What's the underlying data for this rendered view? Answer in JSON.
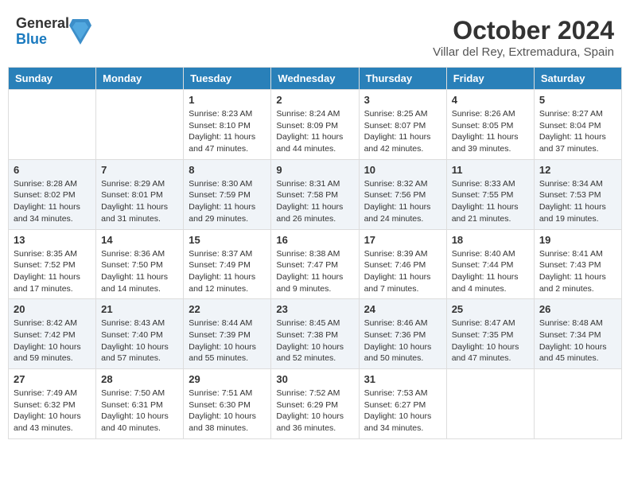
{
  "header": {
    "logo": {
      "general": "General",
      "blue": "Blue"
    },
    "title": "October 2024",
    "subtitle": "Villar del Rey, Extremadura, Spain"
  },
  "weekdays": [
    "Sunday",
    "Monday",
    "Tuesday",
    "Wednesday",
    "Thursday",
    "Friday",
    "Saturday"
  ],
  "weeks": [
    [
      null,
      null,
      {
        "day": "1",
        "sunrise": "Sunrise: 8:23 AM",
        "sunset": "Sunset: 8:10 PM",
        "daylight": "Daylight: 11 hours and 47 minutes."
      },
      {
        "day": "2",
        "sunrise": "Sunrise: 8:24 AM",
        "sunset": "Sunset: 8:09 PM",
        "daylight": "Daylight: 11 hours and 44 minutes."
      },
      {
        "day": "3",
        "sunrise": "Sunrise: 8:25 AM",
        "sunset": "Sunset: 8:07 PM",
        "daylight": "Daylight: 11 hours and 42 minutes."
      },
      {
        "day": "4",
        "sunrise": "Sunrise: 8:26 AM",
        "sunset": "Sunset: 8:05 PM",
        "daylight": "Daylight: 11 hours and 39 minutes."
      },
      {
        "day": "5",
        "sunrise": "Sunrise: 8:27 AM",
        "sunset": "Sunset: 8:04 PM",
        "daylight": "Daylight: 11 hours and 37 minutes."
      }
    ],
    [
      {
        "day": "6",
        "sunrise": "Sunrise: 8:28 AM",
        "sunset": "Sunset: 8:02 PM",
        "daylight": "Daylight: 11 hours and 34 minutes."
      },
      {
        "day": "7",
        "sunrise": "Sunrise: 8:29 AM",
        "sunset": "Sunset: 8:01 PM",
        "daylight": "Daylight: 11 hours and 31 minutes."
      },
      {
        "day": "8",
        "sunrise": "Sunrise: 8:30 AM",
        "sunset": "Sunset: 7:59 PM",
        "daylight": "Daylight: 11 hours and 29 minutes."
      },
      {
        "day": "9",
        "sunrise": "Sunrise: 8:31 AM",
        "sunset": "Sunset: 7:58 PM",
        "daylight": "Daylight: 11 hours and 26 minutes."
      },
      {
        "day": "10",
        "sunrise": "Sunrise: 8:32 AM",
        "sunset": "Sunset: 7:56 PM",
        "daylight": "Daylight: 11 hours and 24 minutes."
      },
      {
        "day": "11",
        "sunrise": "Sunrise: 8:33 AM",
        "sunset": "Sunset: 7:55 PM",
        "daylight": "Daylight: 11 hours and 21 minutes."
      },
      {
        "day": "12",
        "sunrise": "Sunrise: 8:34 AM",
        "sunset": "Sunset: 7:53 PM",
        "daylight": "Daylight: 11 hours and 19 minutes."
      }
    ],
    [
      {
        "day": "13",
        "sunrise": "Sunrise: 8:35 AM",
        "sunset": "Sunset: 7:52 PM",
        "daylight": "Daylight: 11 hours and 17 minutes."
      },
      {
        "day": "14",
        "sunrise": "Sunrise: 8:36 AM",
        "sunset": "Sunset: 7:50 PM",
        "daylight": "Daylight: 11 hours and 14 minutes."
      },
      {
        "day": "15",
        "sunrise": "Sunrise: 8:37 AM",
        "sunset": "Sunset: 7:49 PM",
        "daylight": "Daylight: 11 hours and 12 minutes."
      },
      {
        "day": "16",
        "sunrise": "Sunrise: 8:38 AM",
        "sunset": "Sunset: 7:47 PM",
        "daylight": "Daylight: 11 hours and 9 minutes."
      },
      {
        "day": "17",
        "sunrise": "Sunrise: 8:39 AM",
        "sunset": "Sunset: 7:46 PM",
        "daylight": "Daylight: 11 hours and 7 minutes."
      },
      {
        "day": "18",
        "sunrise": "Sunrise: 8:40 AM",
        "sunset": "Sunset: 7:44 PM",
        "daylight": "Daylight: 11 hours and 4 minutes."
      },
      {
        "day": "19",
        "sunrise": "Sunrise: 8:41 AM",
        "sunset": "Sunset: 7:43 PM",
        "daylight": "Daylight: 11 hours and 2 minutes."
      }
    ],
    [
      {
        "day": "20",
        "sunrise": "Sunrise: 8:42 AM",
        "sunset": "Sunset: 7:42 PM",
        "daylight": "Daylight: 10 hours and 59 minutes."
      },
      {
        "day": "21",
        "sunrise": "Sunrise: 8:43 AM",
        "sunset": "Sunset: 7:40 PM",
        "daylight": "Daylight: 10 hours and 57 minutes."
      },
      {
        "day": "22",
        "sunrise": "Sunrise: 8:44 AM",
        "sunset": "Sunset: 7:39 PM",
        "daylight": "Daylight: 10 hours and 55 minutes."
      },
      {
        "day": "23",
        "sunrise": "Sunrise: 8:45 AM",
        "sunset": "Sunset: 7:38 PM",
        "daylight": "Daylight: 10 hours and 52 minutes."
      },
      {
        "day": "24",
        "sunrise": "Sunrise: 8:46 AM",
        "sunset": "Sunset: 7:36 PM",
        "daylight": "Daylight: 10 hours and 50 minutes."
      },
      {
        "day": "25",
        "sunrise": "Sunrise: 8:47 AM",
        "sunset": "Sunset: 7:35 PM",
        "daylight": "Daylight: 10 hours and 47 minutes."
      },
      {
        "day": "26",
        "sunrise": "Sunrise: 8:48 AM",
        "sunset": "Sunset: 7:34 PM",
        "daylight": "Daylight: 10 hours and 45 minutes."
      }
    ],
    [
      {
        "day": "27",
        "sunrise": "Sunrise: 7:49 AM",
        "sunset": "Sunset: 6:32 PM",
        "daylight": "Daylight: 10 hours and 43 minutes."
      },
      {
        "day": "28",
        "sunrise": "Sunrise: 7:50 AM",
        "sunset": "Sunset: 6:31 PM",
        "daylight": "Daylight: 10 hours and 40 minutes."
      },
      {
        "day": "29",
        "sunrise": "Sunrise: 7:51 AM",
        "sunset": "Sunset: 6:30 PM",
        "daylight": "Daylight: 10 hours and 38 minutes."
      },
      {
        "day": "30",
        "sunrise": "Sunrise: 7:52 AM",
        "sunset": "Sunset: 6:29 PM",
        "daylight": "Daylight: 10 hours and 36 minutes."
      },
      {
        "day": "31",
        "sunrise": "Sunrise: 7:53 AM",
        "sunset": "Sunset: 6:27 PM",
        "daylight": "Daylight: 10 hours and 34 minutes."
      },
      null,
      null
    ]
  ]
}
